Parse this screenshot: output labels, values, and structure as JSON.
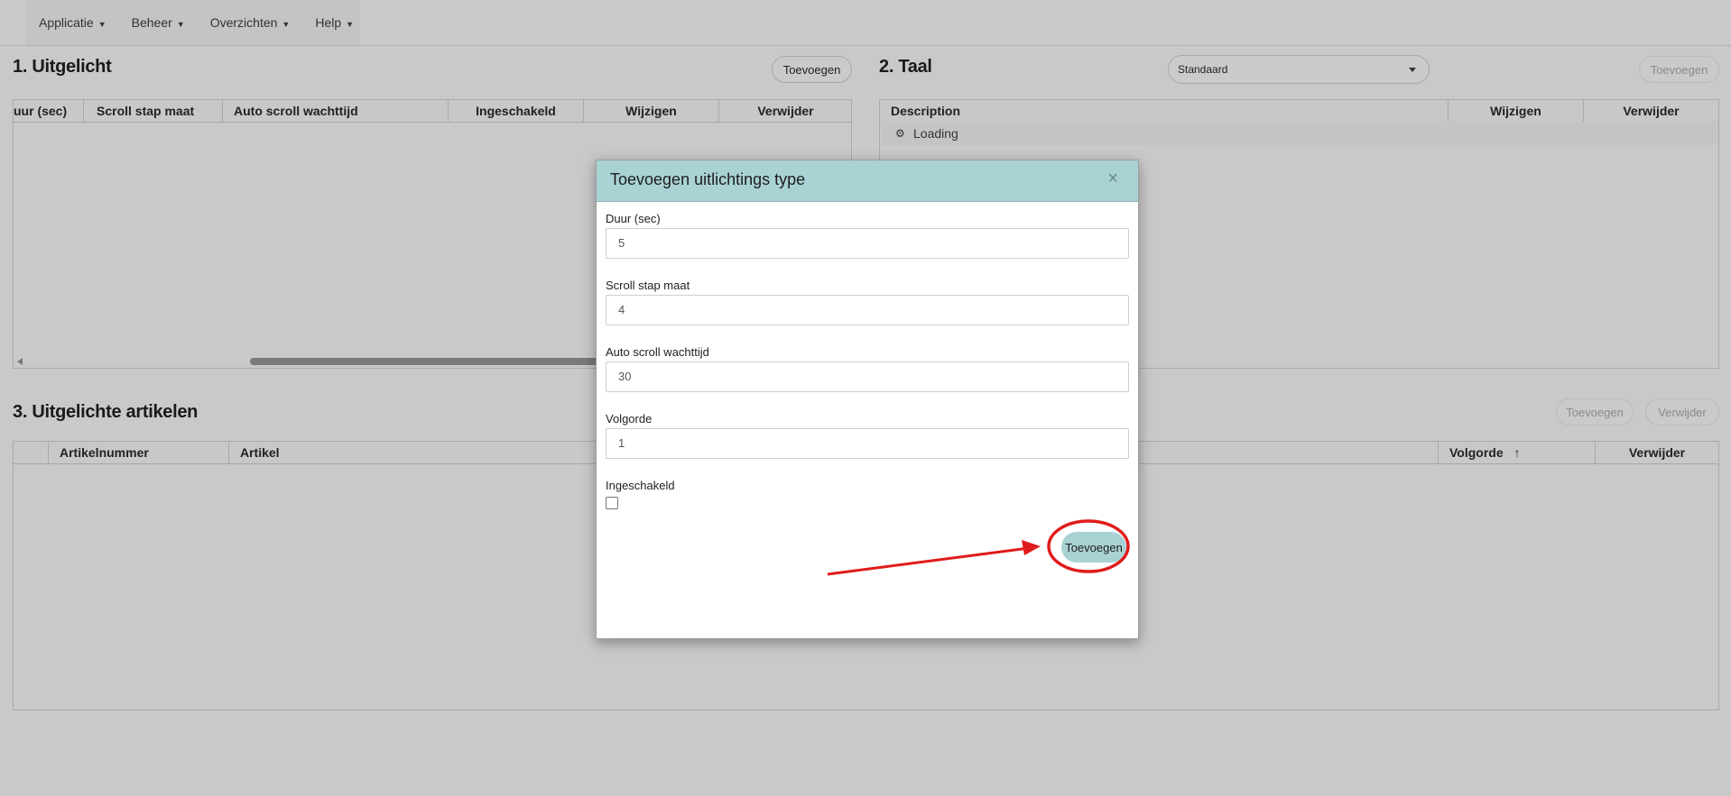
{
  "nav": {
    "items": [
      {
        "label": "Applicatie"
      },
      {
        "label": "Beheer"
      },
      {
        "label": "Overzichten"
      },
      {
        "label": "Help"
      }
    ]
  },
  "section1": {
    "title": "1. Uitgelicht",
    "add_label": "Toevoegen",
    "columns": [
      "uur (sec)",
      "Scroll stap maat",
      "Auto scroll wachttijd",
      "Ingeschakeld",
      "Wijzigen",
      "Verwijder"
    ]
  },
  "section2": {
    "title": "2. Taal",
    "language_select": "Standaard",
    "add_label": "Toevoegen",
    "columns": [
      "Description",
      "Wijzigen",
      "Verwijder"
    ],
    "loading_text": "Loading"
  },
  "section3": {
    "title": "3. Uitgelichte artikelen",
    "add_label": "Toevoegen",
    "delete_label": "Verwijder",
    "columns": [
      "",
      "Artikelnummer",
      "Artikel",
      "Volgorde",
      "Verwijder"
    ],
    "sort_indicator": "↑"
  },
  "modal": {
    "title": "Toevoegen uitlichtings type",
    "close": "×",
    "fields": [
      {
        "label": "Duur (sec)",
        "value": "5"
      },
      {
        "label": "Scroll stap maat",
        "value": "4"
      },
      {
        "label": "Auto scroll wachttijd",
        "value": "30"
      },
      {
        "label": "Volgorde",
        "value": "1"
      }
    ],
    "enabled_label": "Ingeschakeld",
    "enabled_checked": false,
    "submit_label": "Toevoegen"
  },
  "annotation": {
    "color": "#e01b1b"
  }
}
